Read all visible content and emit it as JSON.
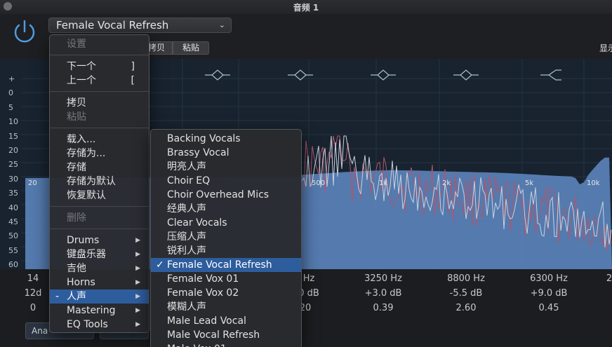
{
  "window": {
    "title": "音频 1"
  },
  "toolbar": {
    "preset": "Female Vocal Refresh",
    "copy_label": "拷贝",
    "paste_label": "粘贴",
    "display_label": "显示"
  },
  "eq": {
    "db_scale": [
      "+",
      "0",
      "5",
      "10",
      "15",
      "20",
      "25",
      "30",
      "35",
      "40",
      "45",
      "50",
      "55",
      "60",
      "-"
    ],
    "freq_labels": [
      "20",
      "500",
      "1k",
      "2k",
      "5k",
      "10k"
    ],
    "colors": {
      "curve_fill": "#5f8ac4",
      "analyzer_red": "#b0566e",
      "analyzer_white": "#c9d2de",
      "background": "#18232f"
    }
  },
  "params": {
    "col0": {
      "freq": "14",
      "gain": "12d",
      "q": "0"
    },
    "col1": {
      "freq": "Hz",
      "gain": "0 dB",
      "q": "20"
    },
    "col2": {
      "freq": "3250 Hz",
      "gain": "+3.0 dB",
      "q": "0.39"
    },
    "col3": {
      "freq": "8800 Hz",
      "gain": "-5.5 dB",
      "q": "2.60"
    },
    "col4": {
      "freq": "6300 Hz",
      "gain": "+9.0 dB",
      "q": "0.45"
    },
    "col5": {
      "freq": "2"
    },
    "analyzer_label": "Ana"
  },
  "menu": {
    "settings": "设置",
    "next": "下一个",
    "next_shortcut": "]",
    "prev": "上一个",
    "prev_shortcut": "[",
    "copy": "拷贝",
    "paste": "粘贴",
    "load": "载入...",
    "save_as": "存储为...",
    "save": "存储",
    "save_default": "存储为默认",
    "restore_default": "恢复默认",
    "delete": "删除",
    "categories": [
      "Drums",
      "键盘乐器",
      "吉他",
      "Horns",
      "人声",
      "Mastering",
      "EQ Tools"
    ],
    "active_category_prefix": "-"
  },
  "submenu": {
    "items": [
      "Backing Vocals",
      "Brassy Vocal",
      "明亮人声",
      "Choir EQ",
      "Choir Overhead Mics",
      "经典人声",
      "Clear Vocals",
      "压缩人声",
      "锐利人声",
      "Female Vocal Refresh",
      "Female Vox 01",
      "Female Vox 02",
      "模糊人声",
      "Male Lead Vocal",
      "Male Vocal Refresh",
      "Male Vox 01"
    ],
    "selected": "Female Vocal Refresh",
    "check": "✓"
  }
}
